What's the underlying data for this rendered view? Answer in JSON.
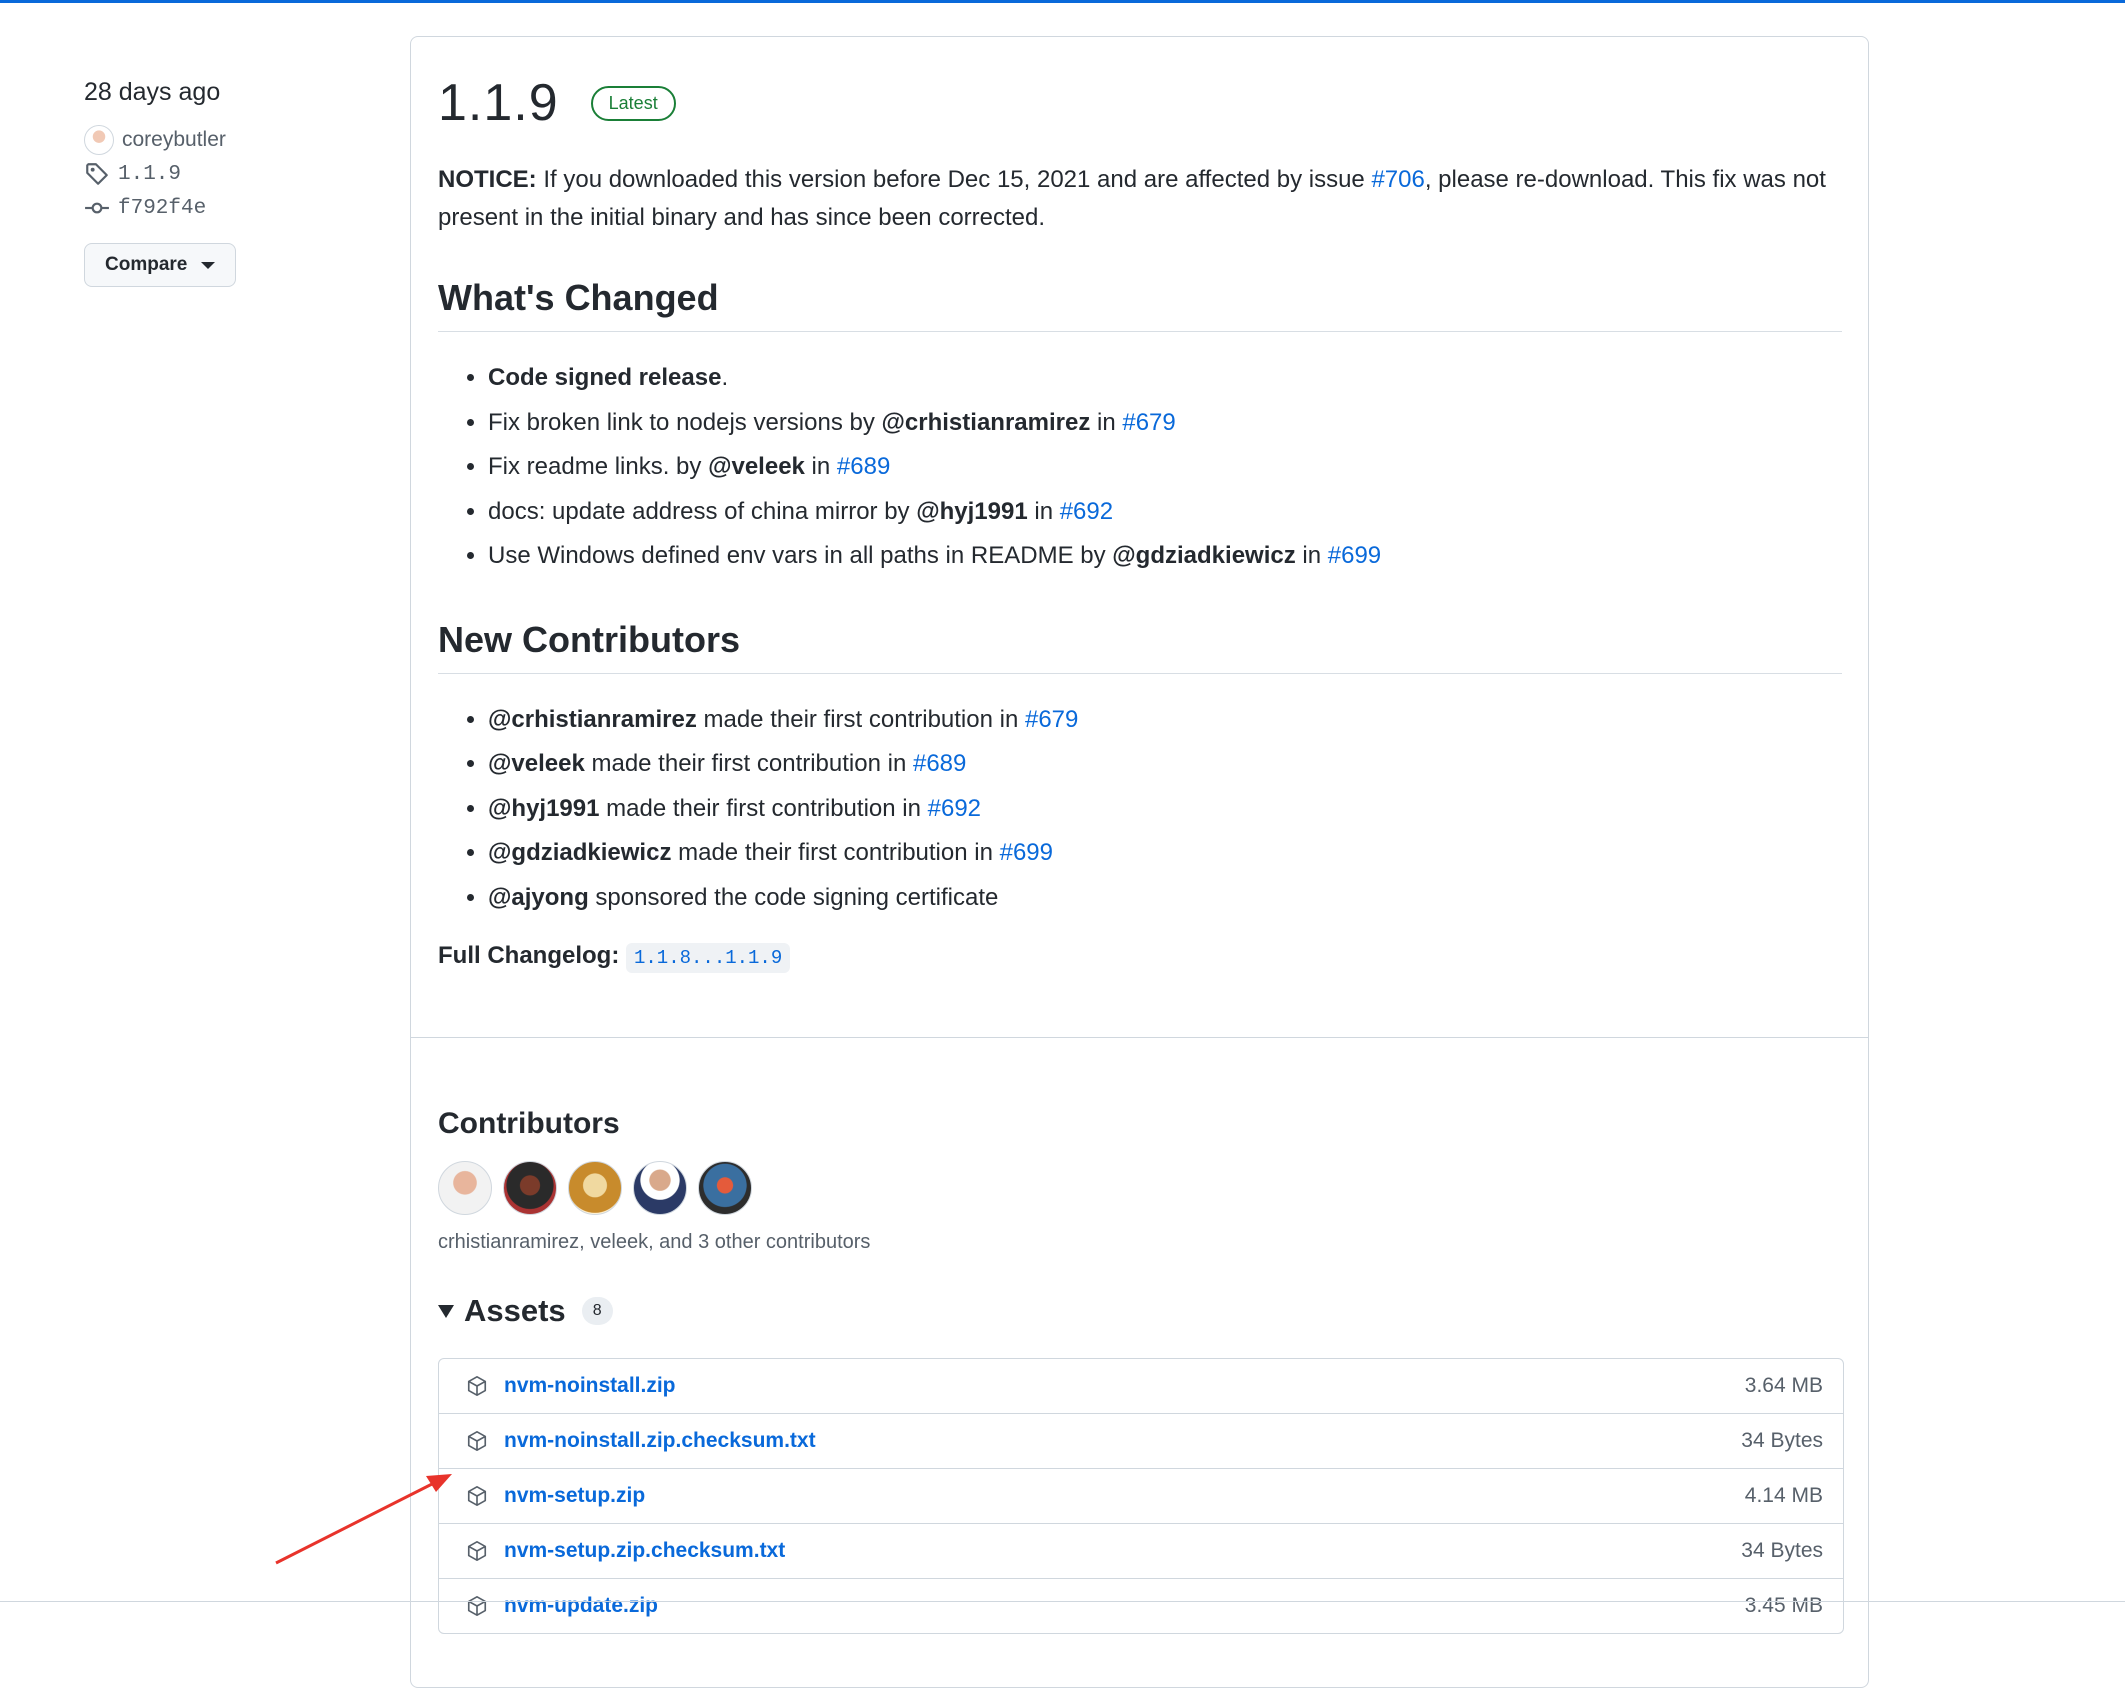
{
  "meta": {
    "time": "28 days ago",
    "author": "coreybutler",
    "tag": "1.1.9",
    "commit": "f792f4e",
    "compare_label": "Compare"
  },
  "release": {
    "version": "1.1.9",
    "badge": "Latest",
    "notice": {
      "label": "NOTICE:",
      "text_before": " If you downloaded this version before Dec 15, 2021 and are affected by issue ",
      "issue": "#706",
      "text_after": ", please re-download. This fix was not present in the initial binary and has since been corrected."
    },
    "whats_changed_heading": "What's Changed",
    "changes": [
      {
        "bold": "Code signed release",
        "tail": "."
      },
      {
        "pre": "Fix broken link to nodejs versions by ",
        "user": "@crhistianramirez",
        "mid": " in ",
        "pr": "#679"
      },
      {
        "pre": "Fix readme links. by ",
        "user": "@veleek",
        "mid": " in ",
        "pr": "#689"
      },
      {
        "pre": "docs: update address of china mirror by ",
        "user": "@hyj1991",
        "mid": " in ",
        "pr": "#692"
      },
      {
        "pre": "Use Windows defined env vars in all paths in README by ",
        "user": "@gdziadkiewicz",
        "mid": " in ",
        "pr": "#699"
      }
    ],
    "new_contributors_heading": "New Contributors",
    "new_contributors": [
      {
        "user": "@crhistianramirez",
        "text": " made their first contribution in ",
        "pr": "#679"
      },
      {
        "user": "@veleek",
        "text": " made their first contribution in ",
        "pr": "#689"
      },
      {
        "user": "@hyj1991",
        "text": " made their first contribution in ",
        "pr": "#692"
      },
      {
        "user": "@gdziadkiewicz",
        "text": " made their first contribution in ",
        "pr": "#699"
      },
      {
        "user": "@ajyong",
        "text": " sponsored the code signing certificate",
        "pr": ""
      }
    ],
    "full_changelog_label": "Full Changelog",
    "full_changelog_link": "1.1.8...1.1.9"
  },
  "contributors": {
    "heading": "Contributors",
    "summary": "crhistianramirez, veleek, and 3 other contributors"
  },
  "assets": {
    "heading": "Assets",
    "count": "8",
    "items": [
      {
        "name": "nvm-noinstall.zip",
        "size": "3.64 MB"
      },
      {
        "name": "nvm-noinstall.zip.checksum.txt",
        "size": "34 Bytes"
      },
      {
        "name": "nvm-setup.zip",
        "size": "4.14 MB"
      },
      {
        "name": "nvm-setup.zip.checksum.txt",
        "size": "34 Bytes"
      },
      {
        "name": "nvm-update.zip",
        "size": "3.45 MB"
      }
    ]
  },
  "colors": {
    "link": "#0969da",
    "latest_badge": "#1a7f37",
    "annotation_arrow": "#e8332b"
  }
}
